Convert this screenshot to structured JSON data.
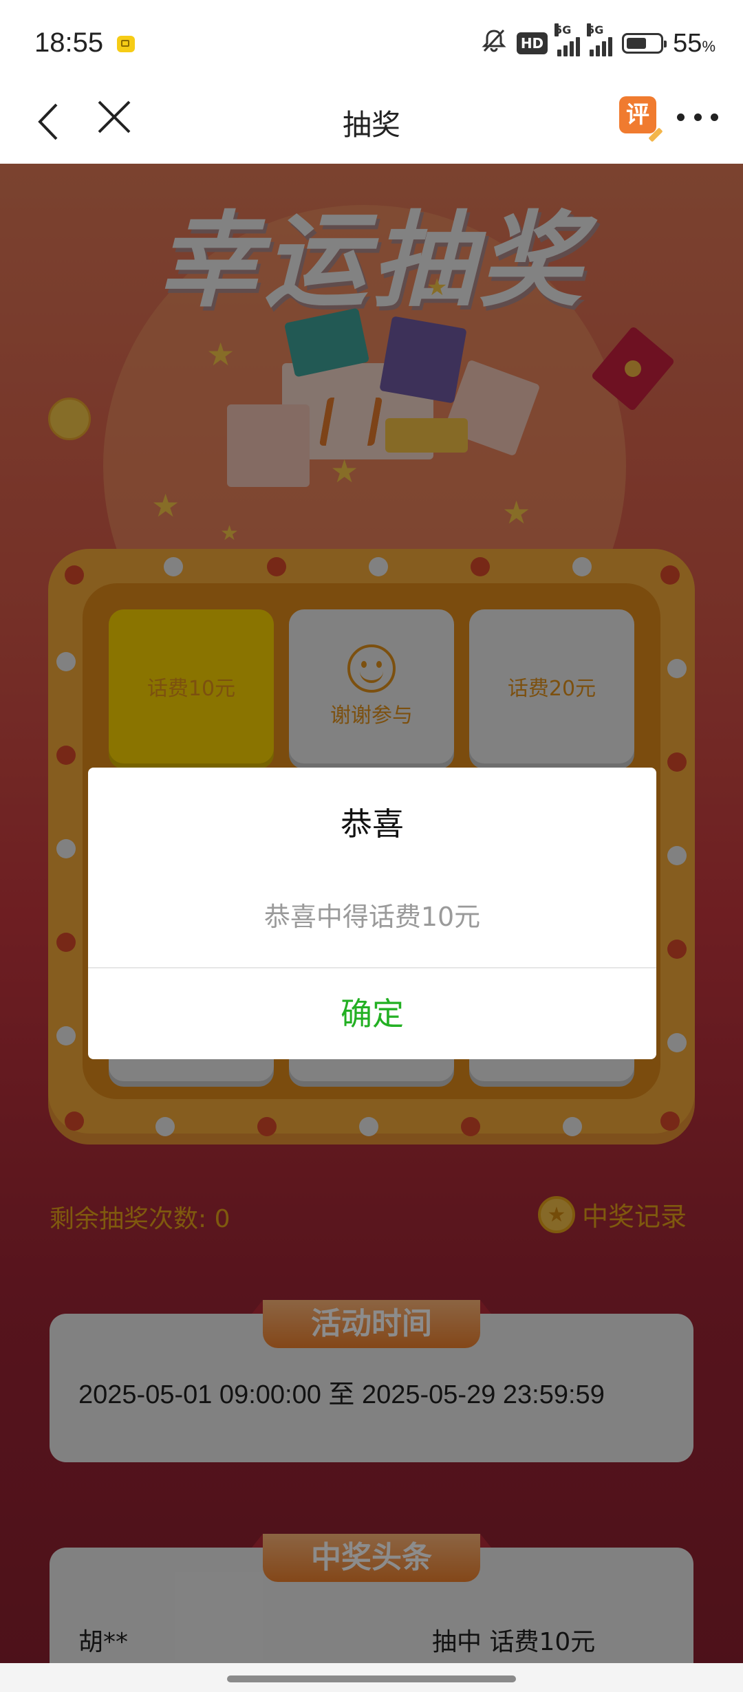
{
  "status_bar": {
    "time": "18:55",
    "hd_label": "HD",
    "network_1": "5G",
    "network_2": "5G",
    "battery_percent": "55",
    "battery_unit": "%",
    "icons": [
      "app-notification-icon",
      "mute-bell-icon",
      "hd-icon",
      "signal-icon",
      "signal-icon",
      "battery-icon"
    ]
  },
  "nav": {
    "title": "抽奖",
    "review_label": "评",
    "icons": [
      "back-icon",
      "close-icon",
      "review-icon",
      "more-icon"
    ]
  },
  "hero": {
    "title": "幸运抽奖"
  },
  "grid": {
    "cells": [
      "话费10元",
      "谢谢参与",
      "话费20元"
    ]
  },
  "lottery": {
    "remaining_label": "剩余抽奖次数: 0",
    "records_label": "中奖记录"
  },
  "activity": {
    "header": "活动时间",
    "time": "2025-05-01 09:00:00  至  2025-05-29 23:59:59"
  },
  "headlines": {
    "header": "中奖头条",
    "name": "胡**",
    "prize": "抽中 话费10元"
  },
  "dialog": {
    "title": "恭喜",
    "message": "恭喜中得话费10元",
    "confirm": "确定"
  },
  "colors": {
    "accent_green": "#23b023",
    "gold": "#e8a51b",
    "highlight_yellow": "#fbd400"
  }
}
